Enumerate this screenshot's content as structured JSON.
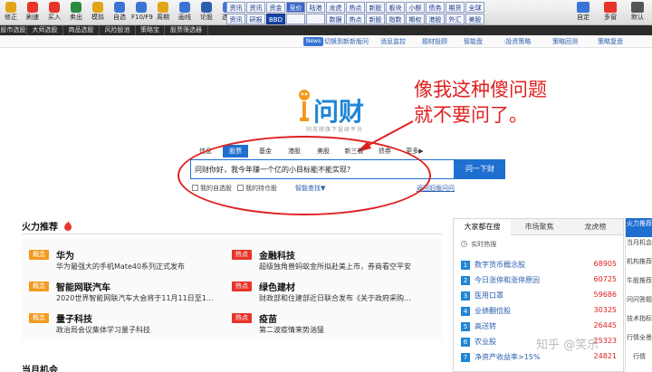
{
  "toolbar": {
    "left_tools": [
      {
        "label": "修正",
        "color": "#e2a51a"
      },
      {
        "label": "刷速",
        "color": "#e8342a"
      },
      {
        "label": "买入",
        "color": "#e8342a"
      },
      {
        "label": "卖出",
        "color": "#2a8a3e"
      },
      {
        "label": "模拟",
        "color": "#e2a51a"
      },
      {
        "label": "自选",
        "color": "#3a75d6"
      },
      {
        "label": "F10/F9",
        "color": "#3a75d6"
      },
      {
        "label": "周期",
        "color": "#e2a51a"
      },
      {
        "label": "画线",
        "color": "#3a75d6"
      },
      {
        "label": "论股",
        "color": "#2b5fae"
      },
      {
        "label": "选股",
        "color": "#3a75d6"
      }
    ],
    "grid_row1": [
      "资讯",
      "资金",
      "竞价",
      "陆港",
      "龙虎",
      "热点",
      "新股",
      "板块",
      "小额",
      "债务",
      "期货",
      "全球"
    ],
    "grid_row2": [
      "研报",
      "BBD",
      "",
      "",
      "数据",
      "热点",
      "新股",
      "指数",
      "期权",
      "港股",
      "外汇",
      "美股"
    ],
    "grid_extra": [
      "资讯",
      "资讯"
    ],
    "right_tools": [
      {
        "label": "自定",
        "color": "#3a75d6"
      },
      {
        "label": "多窗",
        "color": "#e8342a"
      },
      {
        "label": "默认",
        "color": "#555555"
      }
    ]
  },
  "tabbar": [
    "股市选股",
    "大师选股",
    "商品选股",
    "风险股池",
    "策略宝",
    "股票筛选器"
  ],
  "linkbar": {
    "news_badge": "News",
    "news_text": "切换到新新版问",
    "links": [
      "消息监控",
      "题材投顾",
      "智能盘",
      ":投资策略",
      "策略回测",
      "策略复盘"
    ]
  },
  "logo": {
    "brand": "问财",
    "slogan": "同花顺旗下投研平台"
  },
  "annotation": {
    "line1": "像我这种傻问题",
    "line2": "就不要问了。"
  },
  "search": {
    "tabs": [
      "信息",
      "股票",
      "基金",
      "港股",
      "美股",
      "新三板",
      "债券",
      "更多▶"
    ],
    "active_tab_index": 1,
    "query": "问财你好，我今年赚一个亿的小目标能不能实现？",
    "button": "问一下财",
    "opt_selfstock": "我的自选股",
    "opt_holding": "我的持仓股",
    "opt_smart": "智能查找▼",
    "opt_return": "返回旧版问问"
  },
  "hot": {
    "title": "火力推荐",
    "icon": "flame-icon",
    "items": [
      {
        "tag": "概念",
        "title": "华为",
        "desc": "华为最强大的手机Mate40系列正式发布"
      },
      {
        "tag": "热点",
        "title": "金融科技",
        "desc": "超级独角兽蚂蚁金所拟赴美上市，券商看空平安"
      },
      {
        "tag": "概念",
        "title": "智能网联汽车",
        "desc": "2020世界智能网联汽车大会将于11月11日至1..."
      },
      {
        "tag": "热点",
        "title": "绿色建材",
        "desc": "财政部和住建部近日联合发布《关于政府采购..."
      },
      {
        "tag": "概念",
        "title": "量子科技",
        "desc": "政治局会议集体学习量子科技"
      },
      {
        "tag": "热点",
        "title": "疫苗",
        "desc": "第二波疫情来势汹猛"
      }
    ],
    "tag_colors": {
      "概念": "#f39a1e",
      "热点": "#e8342a"
    }
  },
  "rpanel": {
    "tabs": [
      "大家都在搜",
      "市场聚焦",
      "龙虎榜"
    ],
    "subtitle": "实时热搜",
    "rows": [
      {
        "rank": "1",
        "name": "数字货币概念股",
        "value": "68905"
      },
      {
        "rank": "2",
        "name": "今日涨停和涨停原因",
        "value": "60725"
      },
      {
        "rank": "3",
        "name": "医用口罩",
        "value": "59686"
      },
      {
        "rank": "4",
        "name": "业绩翻倍股",
        "value": "30325"
      },
      {
        "rank": "5",
        "name": "高送转",
        "value": "26445"
      },
      {
        "rank": "6",
        "name": "农业股",
        "value": "25323"
      },
      {
        "rank": "7",
        "name": "净资产收益率>15%",
        "value": "24821"
      }
    ]
  },
  "sidebar": [
    "火力推荐",
    "当月机会",
    "机构推荐",
    "牛股推荐",
    "问问答题",
    "技术指标",
    "行情全景",
    "行情"
  ],
  "watermark": "知乎 @笑乐",
  "bottom_title": "当月机会"
}
